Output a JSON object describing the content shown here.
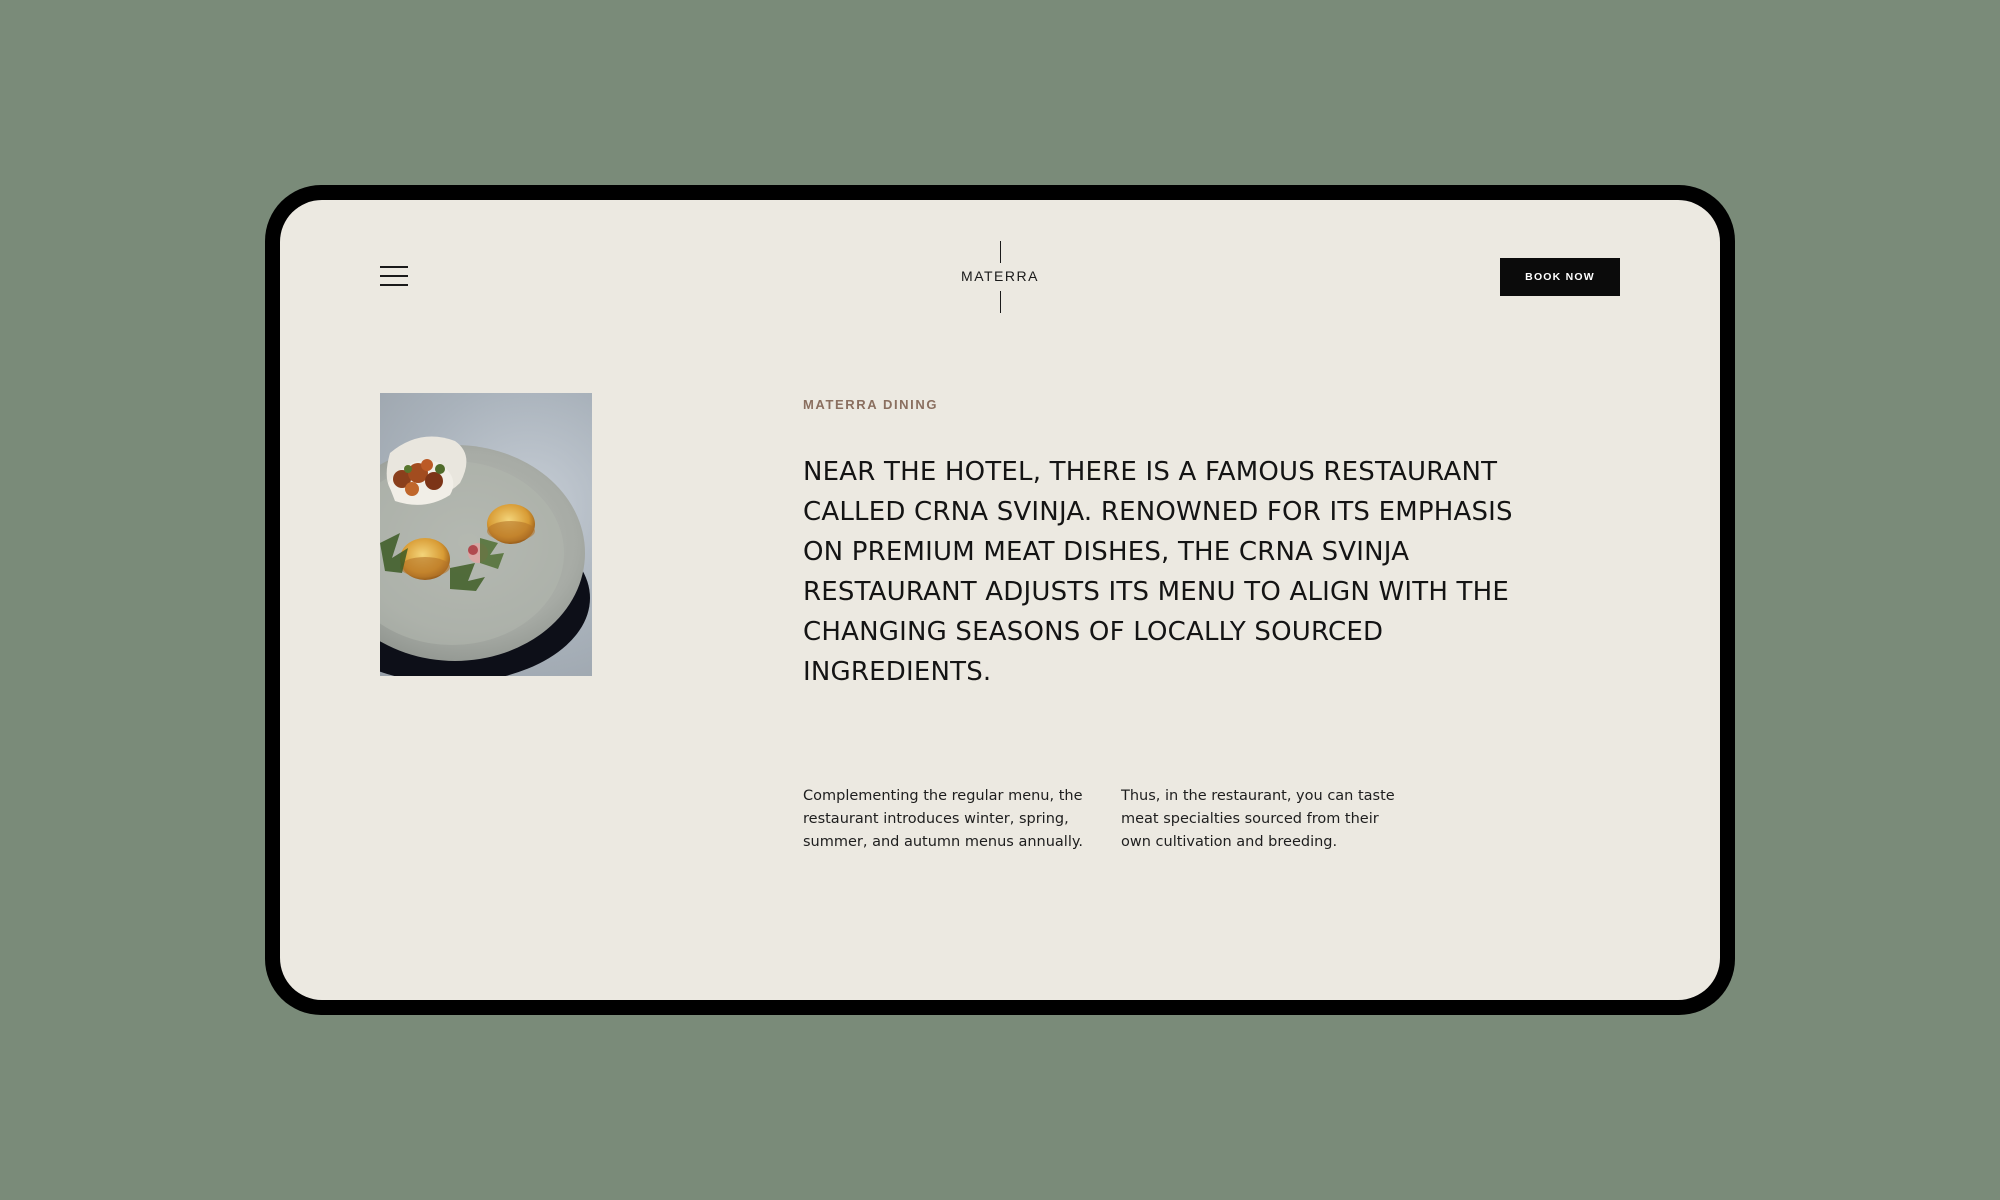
{
  "header": {
    "menu_icon": "hamburger-menu-icon",
    "logo_text": "MATERRA",
    "book_button_label": "BOOK NOW"
  },
  "hero": {
    "image_alt": "plated dish",
    "eyebrow": "MATERRA DINING",
    "headline": "NEAR THE HOTEL, THERE IS A FAMOUS RESTAURANT CALLED CRNA SVINJA. RENOWNED FOR ITS EMPHASIS ON PREMIUM MEAT DISHES, THE CRNA SVINJA RESTAURANT ADJUSTS ITS MENU TO ALIGN WITH THE CHANGING SEASONS OF LOCALLY SOURCED INGREDIENTS."
  },
  "details": {
    "paragraph_left": "Complementing the regular menu, the restaurant introduces winter, spring, summer, and autumn menus annually.",
    "paragraph_right": "Thus, in the restaurant, you can taste meat specialties sourced from their own cultivation and breeding."
  },
  "colors": {
    "background": "#7a8b79",
    "screen": "#ece9e1",
    "accent": "#8a6f5f",
    "button": "#0b0b0b"
  }
}
